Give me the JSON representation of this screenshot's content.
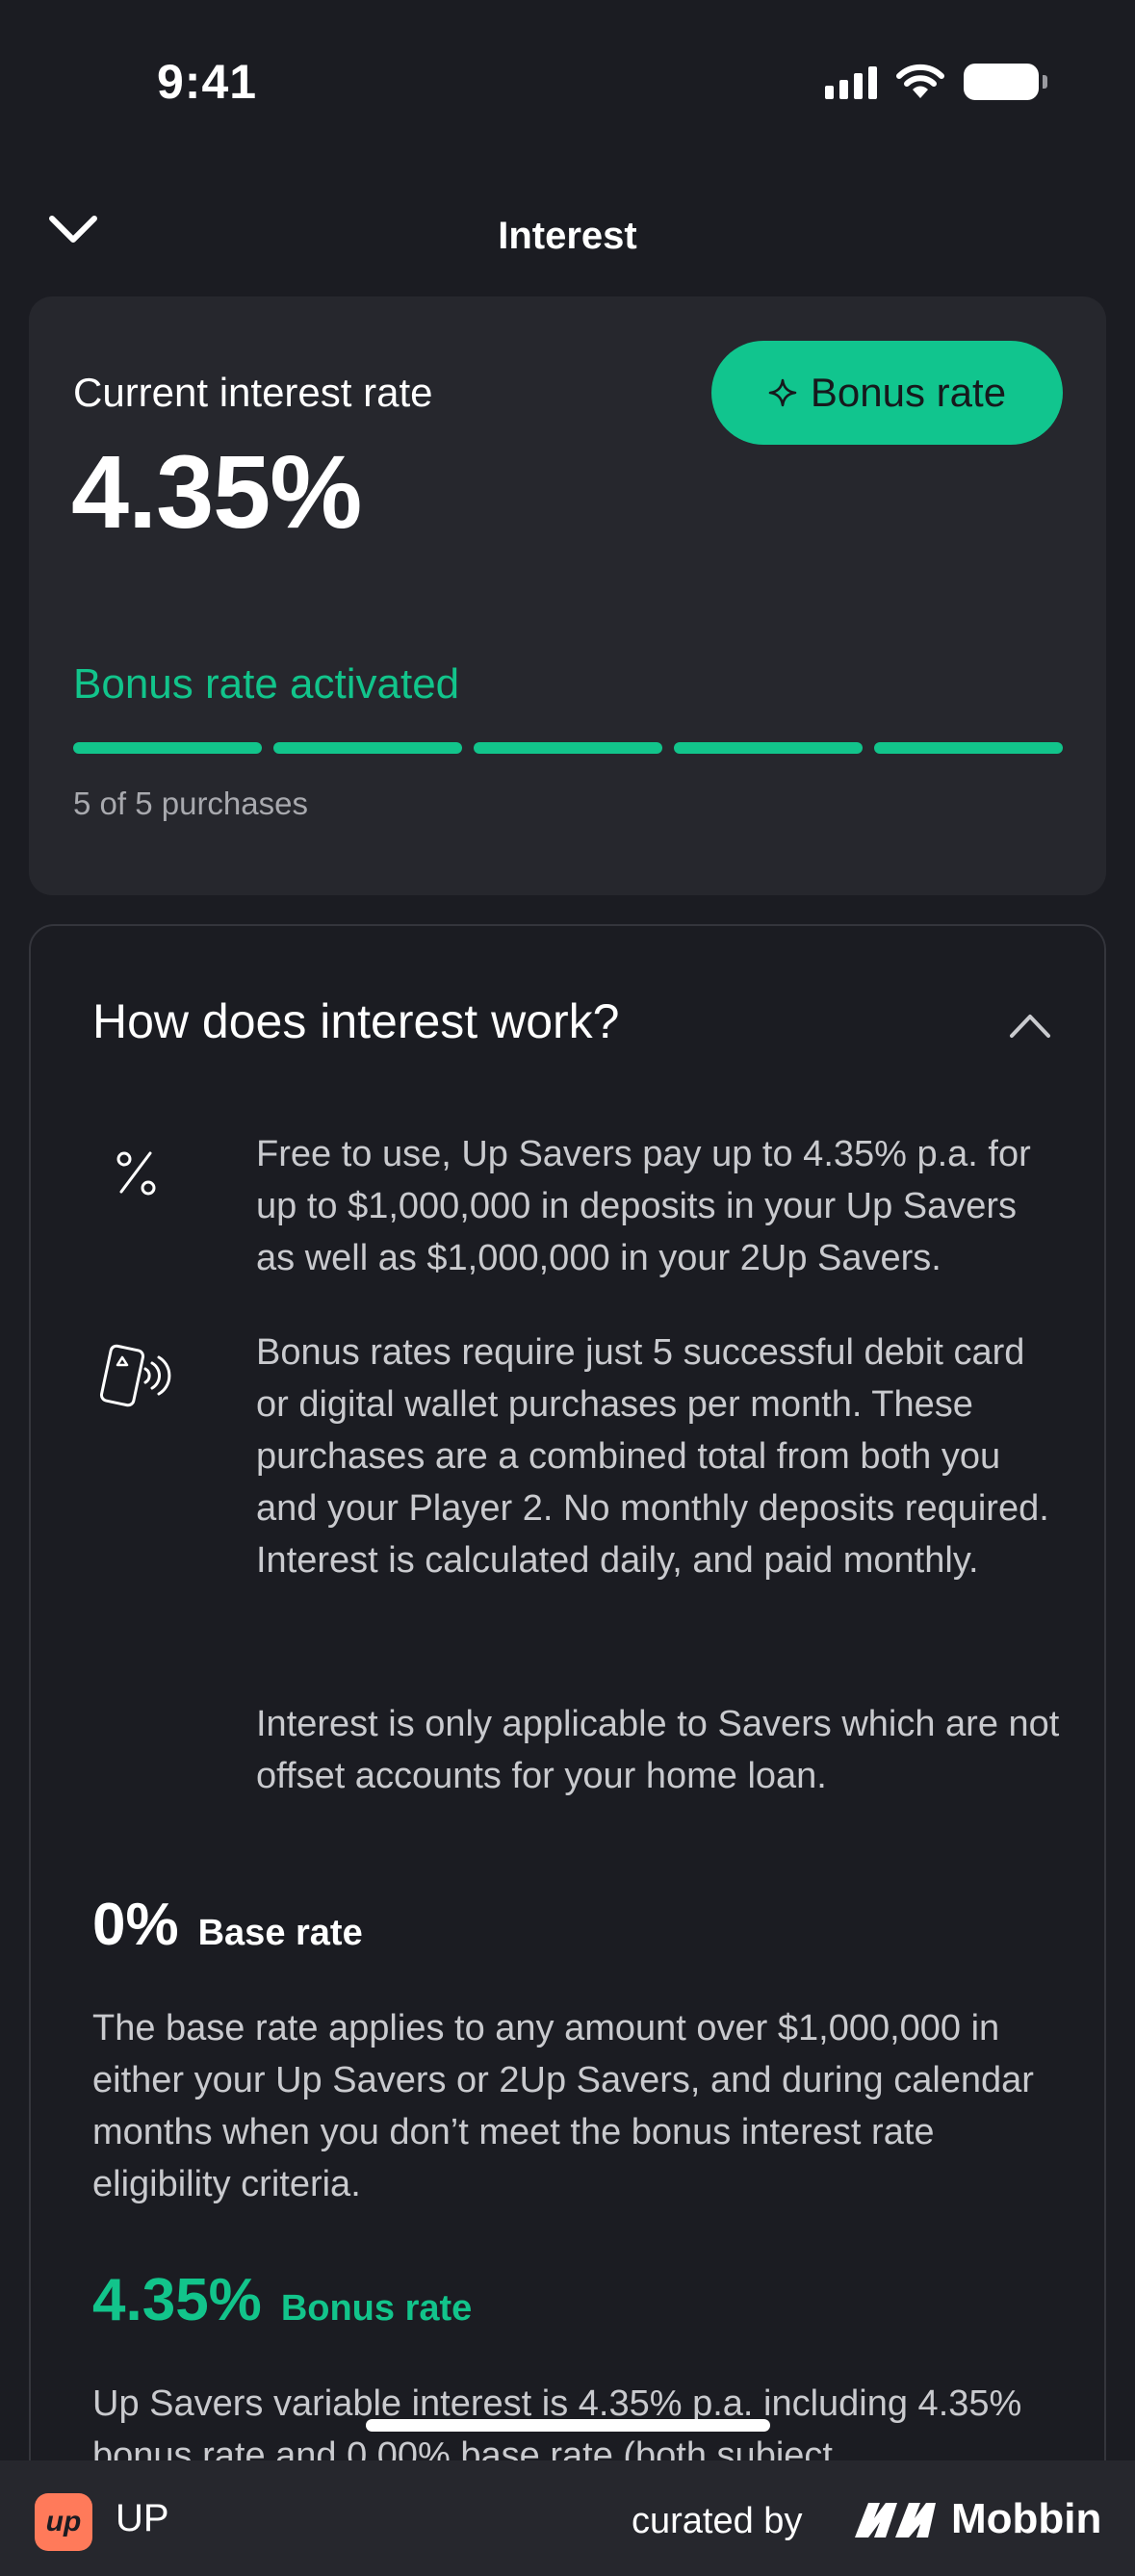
{
  "status_bar": {
    "time": "9:41"
  },
  "header": {
    "title": "Interest"
  },
  "rate_card": {
    "label": "Current interest rate",
    "rate": "4.35%",
    "bonus_button": "Bonus rate",
    "status": "Bonus rate activated",
    "progress": {
      "completed": 5,
      "total": 5
    },
    "progress_text": "5 of 5 purchases"
  },
  "info": {
    "title": "How does interest work?",
    "features": [
      {
        "icon": "percent-icon",
        "text": "Free to use, Up Savers pay up to 4.35% p.a. for up to $1,000,000 in deposits in your Up Savers as well as $1,000,000 in your 2Up Savers."
      },
      {
        "icon": "contactless-card-icon",
        "text": "Bonus rates require just 5 successful debit card or digital wallet purchases per month. These purchases are a combined total from both you and your Player 2. No monthly deposits required. Interest is calculated daily, and paid monthly."
      },
      {
        "icon": "",
        "text": "Interest is only applicable to Savers which are not offset accounts for your home loan."
      }
    ],
    "base": {
      "rate": "0%",
      "label": "Base rate",
      "text": "The base rate applies to any amount over $1,000,000 in either your Up Savers or 2Up Savers, and during calendar months when you don’t meet the bonus interest rate eligibility criteria."
    },
    "bonus": {
      "rate": "4.35%",
      "label": "Bonus rate",
      "text": "Up Savers variable interest is 4.35% p.a. including 4.35% bonus rate and 0.00% base rate (both subject"
    }
  },
  "footer": {
    "app_name": "UP",
    "app_logo_text": "up",
    "curated_by": "curated by",
    "brand": "Mobbin"
  },
  "colors": {
    "accent": "#12c48b",
    "background": "#1b1c22",
    "card": "#26272d"
  }
}
